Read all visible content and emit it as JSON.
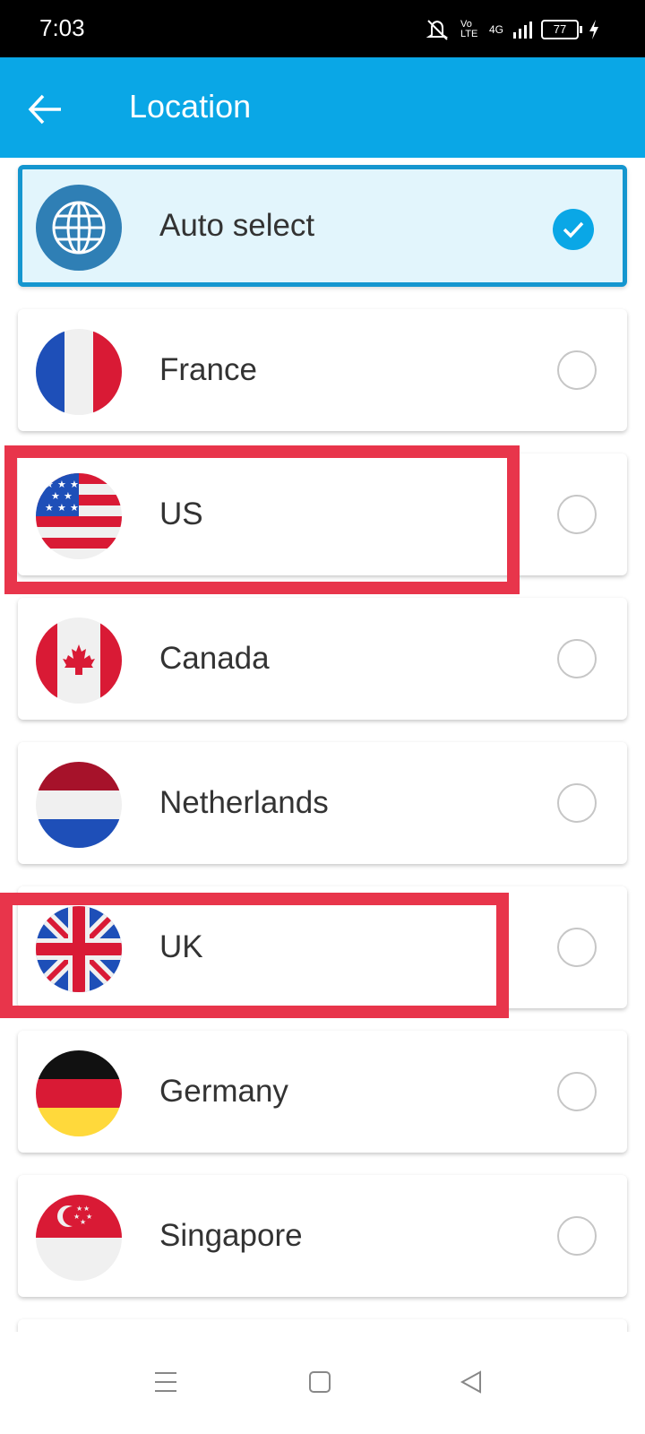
{
  "status_bar": {
    "time": "7:03",
    "network_label": "4G",
    "volte_label": "Vo LTE",
    "battery": "77"
  },
  "app_bar": {
    "title": "Location"
  },
  "locations": [
    {
      "label": "Auto select",
      "selected": true,
      "icon": "globe-icon"
    },
    {
      "label": "France",
      "selected": false,
      "icon": "france-flag-icon"
    },
    {
      "label": "US",
      "selected": false,
      "icon": "us-flag-icon"
    },
    {
      "label": "Canada",
      "selected": false,
      "icon": "canada-flag-icon"
    },
    {
      "label": "Netherlands",
      "selected": false,
      "icon": "netherlands-flag-icon"
    },
    {
      "label": "UK",
      "selected": false,
      "icon": "uk-flag-icon"
    },
    {
      "label": "Germany",
      "selected": false,
      "icon": "germany-flag-icon"
    },
    {
      "label": "Singapore",
      "selected": false,
      "icon": "singapore-flag-icon"
    }
  ],
  "colors": {
    "app_bar": "#0aa7e6",
    "selected_border": "#1596cf",
    "selected_bg": "#e2f5fc",
    "highlight": "#e8354b"
  }
}
